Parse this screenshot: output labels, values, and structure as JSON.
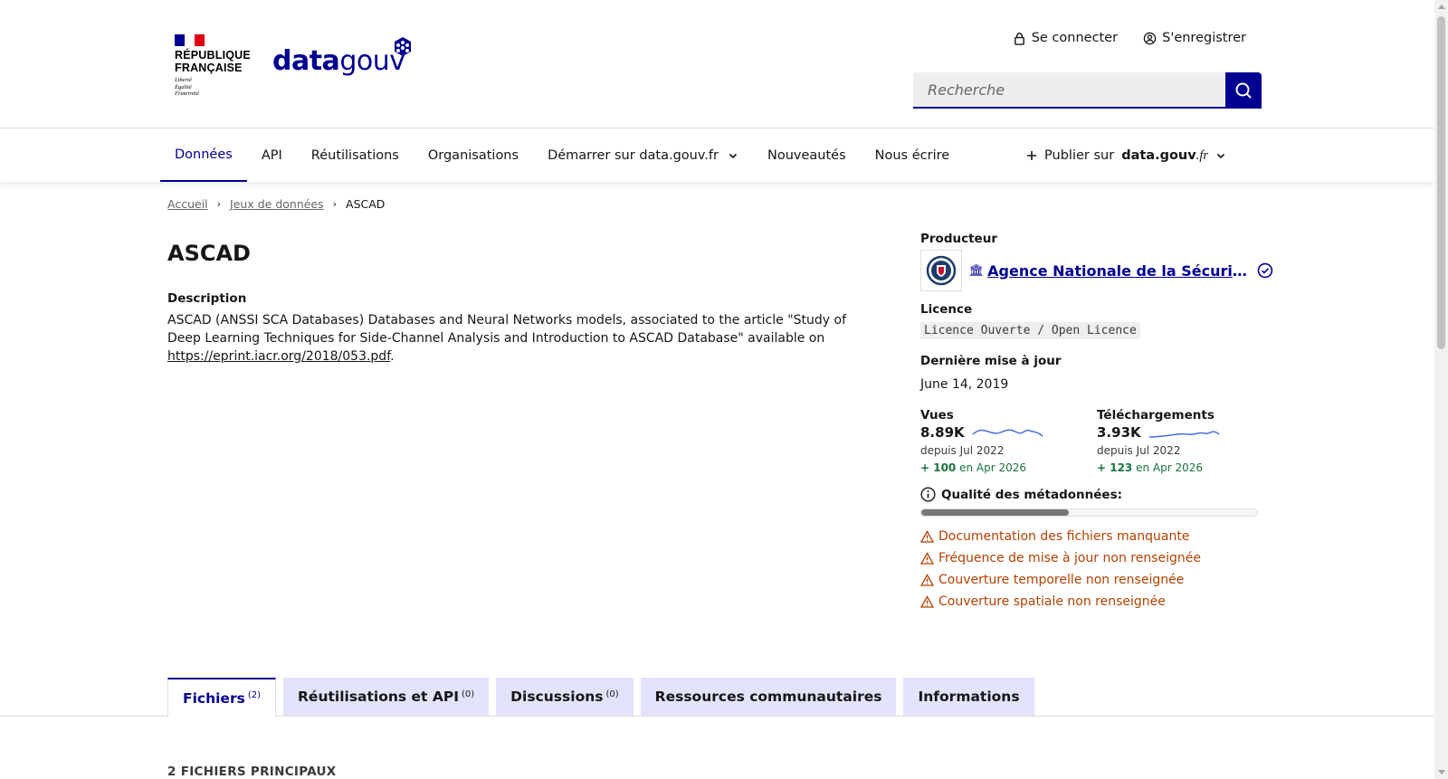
{
  "header": {
    "marianne_title_line1": "RÉPUBLIQUE",
    "marianne_title_line2": "FRANÇAISE",
    "marianne_motto": [
      "Liberté",
      "Égalité",
      "Fraternité"
    ],
    "logo_bold": "data",
    "logo_light": "gouv",
    "login_label": "Se connecter",
    "register_label": "S'enregistrer",
    "search_placeholder": "Recherche"
  },
  "nav": {
    "items": [
      {
        "label": "Données",
        "active": true
      },
      {
        "label": "API"
      },
      {
        "label": "Réutilisations"
      },
      {
        "label": "Organisations"
      },
      {
        "label": "Démarrer sur data.gouv.fr",
        "dropdown": true
      },
      {
        "label": "Nouveautés"
      },
      {
        "label": "Nous écrire"
      }
    ],
    "publish_prefix": "Publier sur",
    "publish_brand": "data.gouv",
    "publish_suffix": ".fr"
  },
  "breadcrumb": {
    "home": "Accueil",
    "datasets": "Jeux de données",
    "current": "ASCAD"
  },
  "dataset": {
    "title": "ASCAD",
    "description_label": "Description",
    "description_text": "ASCAD (ANSSI SCA Databases) Databases and Neural Networks models, associated to the article \"Study of Deep Learning Techniques for Side-Channel Analysis and Introduction to ASCAD Database\" available on ",
    "description_link": "https://eprint.iacr.org/2018/053.pdf",
    "description_end": "."
  },
  "sidebar": {
    "producer_label": "Producteur",
    "producer_name": "Agence Nationale de la Sécurité des Systèmes d'Information",
    "licence_label": "Licence",
    "licence_value": "Licence Ouverte / Open Licence",
    "updated_label": "Dernière mise à jour",
    "updated_value": "June 14, 2019",
    "views": {
      "label": "Vues",
      "value": "8.89K",
      "since": "depuis Jul 2022",
      "delta": "+ 100",
      "delta_suffix": "en Apr 2026"
    },
    "downloads": {
      "label": "Téléchargements",
      "value": "3.93K",
      "since": "depuis Jul 2022",
      "delta": "+ 123",
      "delta_suffix": "en Apr 2026"
    },
    "quality_label": "Qualité des métadonnées:",
    "quality_score": 0.44,
    "warnings": [
      "Documentation des fichiers manquante",
      "Fréquence de mise à jour non renseignée",
      "Couverture temporelle non renseignée",
      "Couverture spatiale non renseignée"
    ]
  },
  "tabs": [
    {
      "label": "Fichiers",
      "count": "(2)",
      "active": true
    },
    {
      "label": "Réutilisations et API",
      "count": "(0)"
    },
    {
      "label": "Discussions",
      "count": "(0)"
    },
    {
      "label": "Ressources communautaires",
      "count": ""
    },
    {
      "label": "Informations",
      "count": ""
    }
  ],
  "files_title": "2 FICHIERS PRINCIPAUX",
  "colors": {
    "brand_blue": "#000091",
    "warning_orange": "#b34000",
    "success_green": "#18753c",
    "tab_bg": "#e3e3fd"
  }
}
